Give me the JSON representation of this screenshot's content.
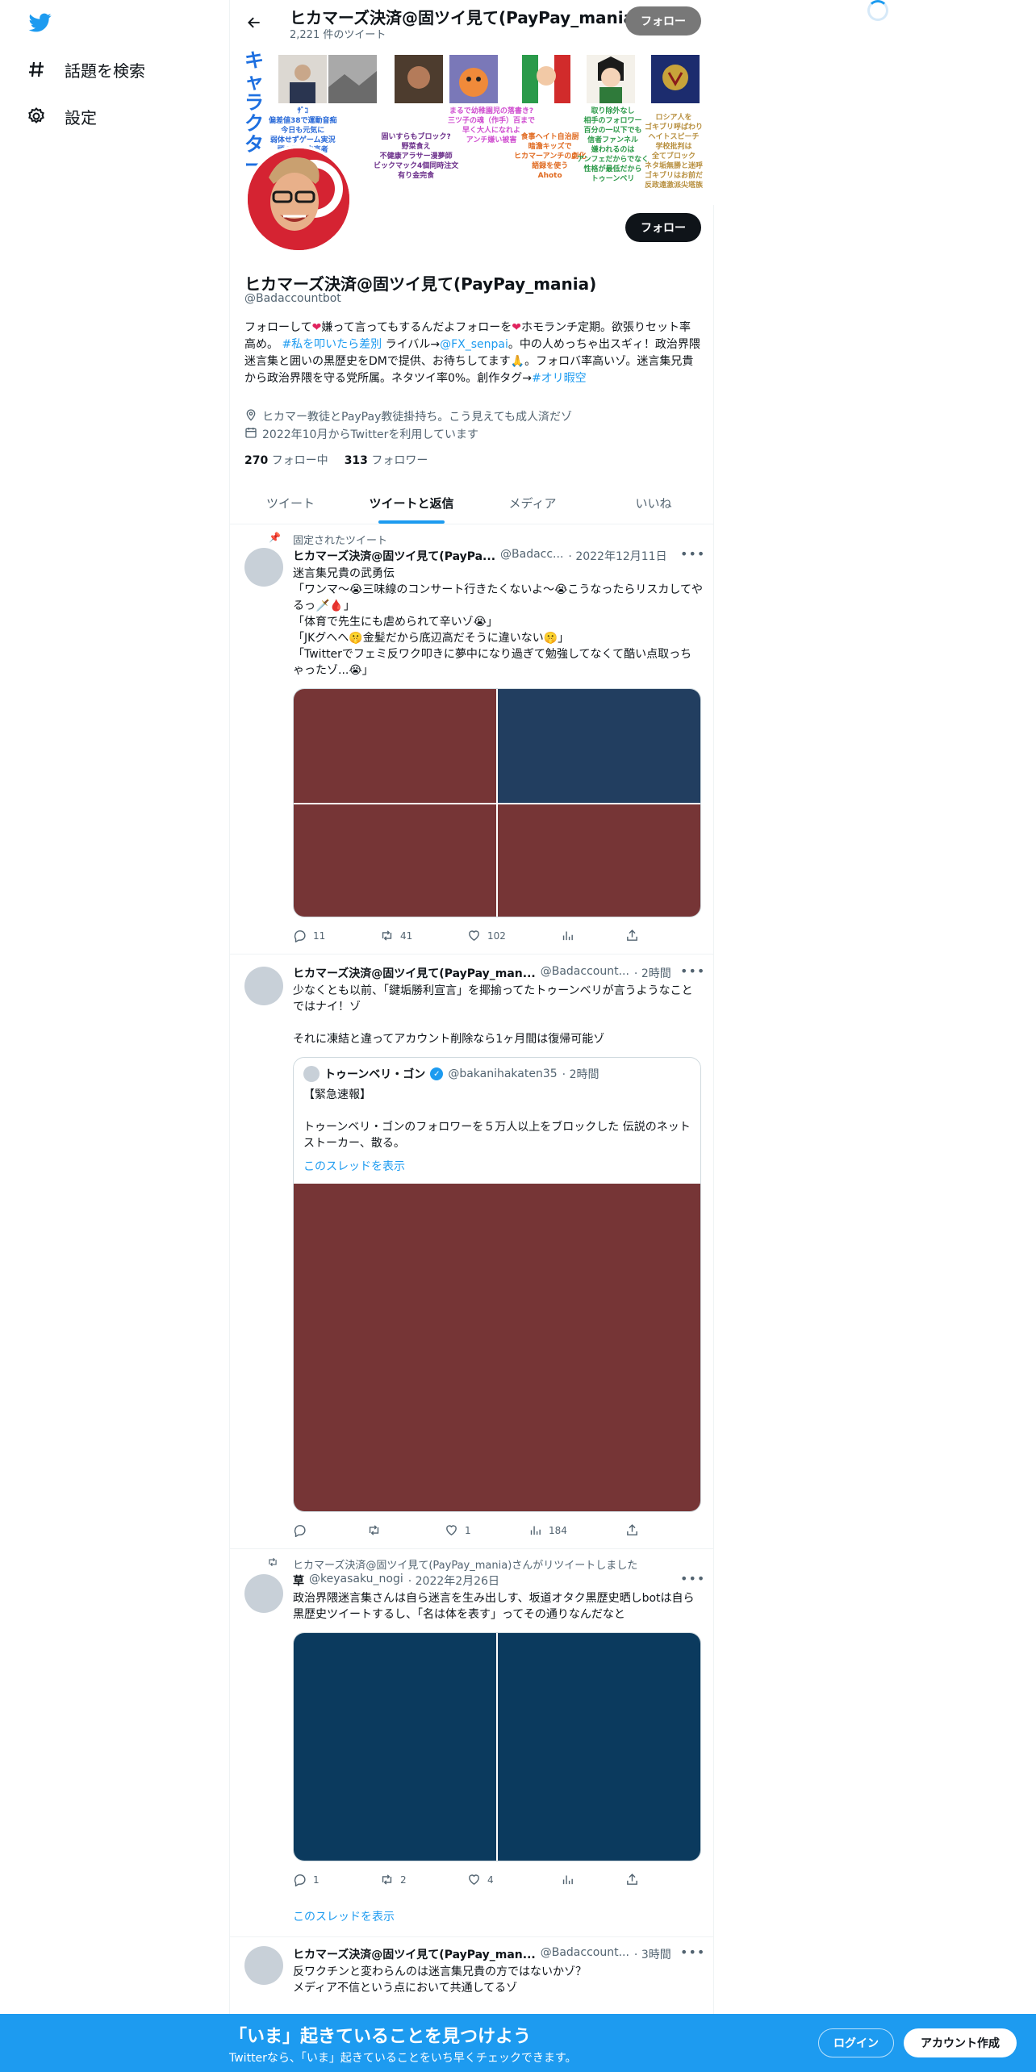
{
  "sidebar": {
    "items": [
      {
        "label": "話題を検索",
        "icon": "hashtag-icon"
      },
      {
        "label": "設定",
        "icon": "gear-icon"
      }
    ]
  },
  "header": {
    "title": "ヒカマーズ決済@固ツイ見て(PayPay_mania)",
    "tweet_count": "2,221 件のツイート",
    "follow_label": "フォロー"
  },
  "banner": {
    "vertical_text": "キャラクター",
    "captions": [
      "ｻﾞｺ\n偏差値38で運動音痴\n今日も元気に\n弱体せずゲーム実況\n頭の悪い中高者\n弱すぎる\n仕様",
      "固いすらもブロック?\n野菜食え\n不健康アラサー漫夢師\nビックマック4個同時注文\n有り金完食",
      "まるで幼稚園児の落書き?\n三ツ子の魂（作手）百まで\n早く大人になれよ\nアンチ嫌い被害",
      "食事ヘイト自治厨\n暗澹キッズで\nヒカマーアンチの劇化\n語録を使う\nAhoto",
      "取り除外なし\n相手のフォロワー\n百分の一以下でも\n信者ファンネル\n嫌われるのは\nアンフェだからでなく\n性格が最低だから\nトゥーンベリ",
      "ロシア人を\nゴキブリ呼ばわり\nヘイトスピーチ\n学校批判は\n全てブロック\nネタ垢無勝と迷呼\nゴキブリはお前だ\n反政遠激派尖塔族"
    ]
  },
  "profile": {
    "name": "ヒカマーズ決済@固ツイ見て(PayPay_mania)",
    "handle": "@Badaccountbot",
    "follow_label": "フォロー",
    "bio_1": "フォローして",
    "bio_2": "嫌って言ってもするんだよフォローを",
    "bio_3": "ホモランチ定期。欲張りセット率高め。",
    "bio_tag": "#私を叩いたら差別",
    "bio_4": " ライバル→",
    "bio_mention": "@FX_senpai",
    "bio_5": "。中の人めっちゃ出スギィ！政治界隈迷言集と囲いの黒歴史をDMで提供、お待ちしてます🙏。フォロバ率高いゾ。迷言集兄貴から政治界隈を守る党所属。ネタツイ率0%。創作タグ→",
    "bio_tag2": "#オリ暇空",
    "location": "ヒカマー教徒とPayPay教徒掛持ち。こう見えても成人済だゾ",
    "joined": "2022年10月からTwitterを利用しています",
    "following_count": "270",
    "following_label": "フォロー中",
    "followers_count": "313",
    "followers_label": "フォロワー"
  },
  "tabs": [
    "ツイート",
    "ツイートと返信",
    "メディア",
    "いいね"
  ],
  "tweets": [
    {
      "social": "固定されたツイート",
      "name": "ヒカマーズ決済@固ツイ見て(PayPa...",
      "handle": "@Badacc...",
      "time": "· 2022年12月11日",
      "text": "迷言集兄貴の武勇伝\n「ワンマ〜😭三味線のコンサート行きたくないよ〜😭こうなったらリスカしてやるっ🗡️🩸」\n「体育で先生にも虐められて辛いゾ😭」\n「JKグヘヘ🤫金髪だから底辺高だそうに違いない🤫」\n「Twitterでフェミ反ワク叩きに夢中になり過ぎて勉強してなくて酷い点取っちゃったゾ...😭」",
      "replies": "11",
      "retweets": "41",
      "likes": "102",
      "views": ""
    },
    {
      "social": "",
      "name": "ヒカマーズ決済@固ツイ見て(PayPay_man...",
      "handle": "@Badaccount...",
      "time": "· 2時間",
      "text": "少なくとも以前、「鍵垢勝利宣言」を揶揄ってたトゥーンベリが言うようなことではナイ！ゾ\n\nそれに凍結と違ってアカウント削除なら1ヶ月間は復帰可能ゾ",
      "quote": {
        "name": "トゥーンベリ・ゴン",
        "handle": "@bakanihakaten35",
        "time": "· 2時間",
        "text": "【緊急速報】\n\nトゥーンベリ・ゴンのフォロワーを５万人以上をブロックした 伝説のネットストーカー、散る。",
        "thread": "このスレッドを表示"
      },
      "replies": "",
      "retweets": "",
      "likes": "1",
      "views": "184"
    },
    {
      "social": "ヒカマーズ決済@固ツイ見て(PayPay_mania)さんがリツイートしました",
      "name": "草",
      "handle": "@keyasaku_nogi",
      "time": "· 2022年2月26日",
      "text": "政治界隈迷言集さんは自ら迷言を生み出しす、坂道オタク黒歴史晒しbotは自ら黒歴史ツイートするし、「名は体を表す」ってその通りなんだなと",
      "replies": "1",
      "retweets": "2",
      "likes": "4",
      "views": "",
      "thread": "このスレッドを表示"
    },
    {
      "social": "",
      "name": "ヒカマーズ決済@固ツイ見て(PayPay_man...",
      "handle": "@Badaccount...",
      "time": "· 3時間",
      "text": "反ワクチンと変わらんのは迷言集兄貴の方ではないかゾ？\nメディア不信という点において共通してるゾ"
    }
  ],
  "bottom_bar": {
    "title": "「いま」起きていることを見つけよう",
    "subtitle": "Twitterなら、「いま」起きていることをいち早くチェックできます。",
    "login": "ログイン",
    "signup": "アカウント作成"
  },
  "colors": {
    "accent": "#1d9bf0",
    "media_red": "#763536",
    "media_blue": "#223e60",
    "media_navy": "#0b3a5e"
  }
}
